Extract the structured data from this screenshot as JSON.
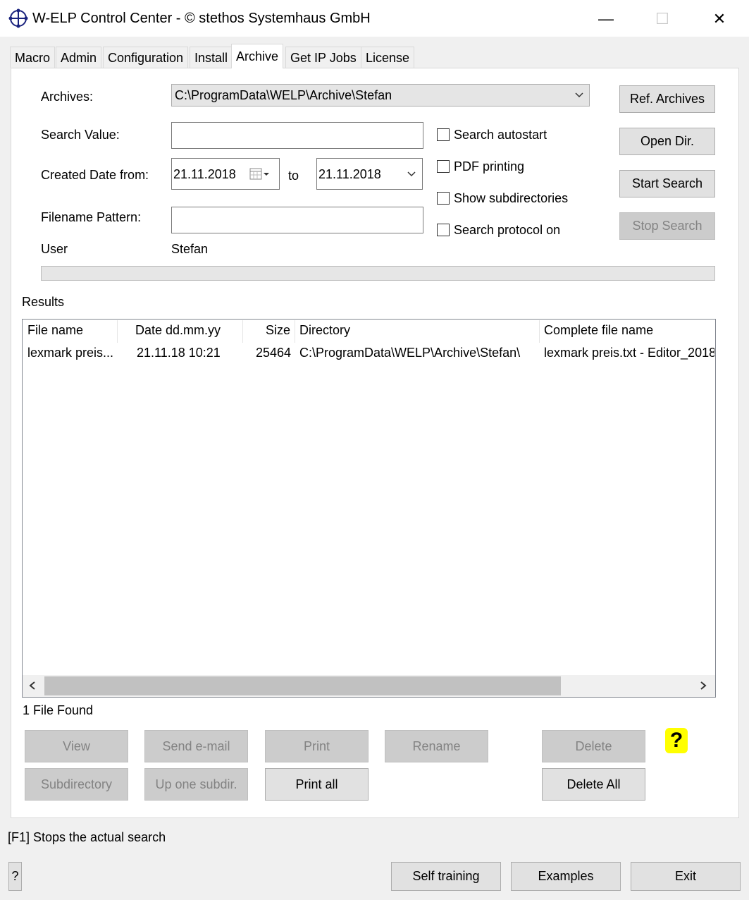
{
  "window": {
    "title": "W-ELP Control Center - © stethos Systemhaus GmbH",
    "minimize_glyph": "—",
    "maximize_glyph": "☐",
    "close_glyph": "✕"
  },
  "tabs": [
    "Macro",
    "Admin",
    "Configuration",
    "Install",
    "Archive",
    "Get IP Jobs",
    "License"
  ],
  "form": {
    "archives_label": "Archives:",
    "archives_value": "C:\\ProgramData\\WELP\\Archive\\Stefan",
    "search_value_label": "Search Value:",
    "search_value": "",
    "created_date_label": "Created Date from:",
    "date_from": "21.11.2018",
    "to_label": "to",
    "date_to": "21.11.2018",
    "filename_pattern_label": "Filename Pattern:",
    "filename_pattern": "",
    "user_label": "User",
    "user_value": "Stefan"
  },
  "checkboxes": {
    "search_autostart": "Search autostart",
    "pdf_printing": "PDF printing",
    "show_subdirectories": "Show subdirectories",
    "search_protocol_on": "Search protocol on"
  },
  "side_buttons": {
    "ref_archives": "Ref. Archives",
    "open_dir": "Open Dir.",
    "start_search": "Start Search",
    "stop_search": "Stop Search"
  },
  "results": {
    "label": "Results",
    "columns": {
      "file_name": "File name",
      "date": "Date  dd.mm.yy",
      "size": "Size",
      "directory": "Directory",
      "complete_file_name": "Complete file name"
    },
    "rows": [
      {
        "file_name": "lexmark preis...",
        "date": "21.11.18  10:21",
        "size": "25464",
        "directory": "C:\\ProgramData\\WELP\\Archive\\Stefan\\",
        "complete_file_name": "lexmark preis.txt - Editor_2018"
      }
    ],
    "count_text": "1 File Found"
  },
  "action_buttons": {
    "view": "View",
    "send_email": "Send e-mail",
    "print": "Print",
    "rename": "Rename",
    "delete": "Delete",
    "subdirectory": "Subdirectory",
    "up_one_subdir": "Up one subdir.",
    "print_all": "Print all",
    "delete_all": "Delete All",
    "help": "?"
  },
  "status_text": "[F1] Stops the actual search",
  "bottom": {
    "question": "?",
    "self_training": "Self training",
    "examples": "Examples",
    "exit": "Exit"
  },
  "colors": {
    "disabled_button_bg": "#cccccc",
    "help_highlight": "#ffff00",
    "scroll_thumb": "#c1c1c1"
  }
}
